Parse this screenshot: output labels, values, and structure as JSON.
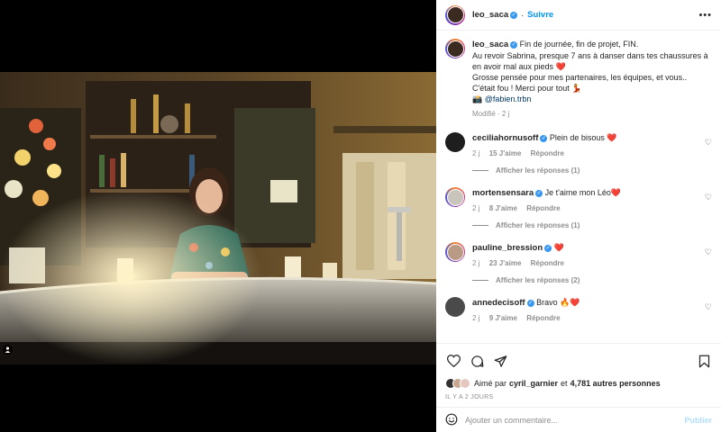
{
  "post": {
    "author": "leo_saca",
    "follow_label": "Suivre",
    "more_icon": "more-dots-icon"
  },
  "caption": {
    "author": "leo_saca",
    "line1": "Fin de journée, fin de projet, FIN.",
    "line2": "Au revoir Sabrina, presque 7 ans à danser dans tes chaussures à en avoir mal aux pieds ❤️",
    "line3": "Grosse pensée pour mes partenaires, les équipes, et vous..",
    "line4": "C'était fou ! Merci pour tout 💃",
    "line5_prefix": "📸",
    "mention": "@fabien.trbn",
    "edited": "Modifié · 2 j"
  },
  "comments": [
    {
      "user": "ceciliahornusoff",
      "text": "Plein de bisous ❤️",
      "age": "2 j",
      "likes": "15 J'aime",
      "reply": "Répondre",
      "replies": "Afficher les réponses (1)"
    },
    {
      "user": "mortensensara",
      "text": "Je t'aime mon Léo❤️",
      "age": "2 j",
      "likes": "8 J'aime",
      "reply": "Répondre",
      "replies": "Afficher les réponses (1)"
    },
    {
      "user": "pauline_bression",
      "text": "❤️",
      "age": "2 j",
      "likes": "23 J'aime",
      "reply": "Répondre",
      "replies": "Afficher les réponses (2)"
    },
    {
      "user": "annedecisoff",
      "text": "Bravo 🔥❤️",
      "age": "2 j",
      "likes": "9 J'aime",
      "reply": "Répondre",
      "replies": ""
    }
  ],
  "likes": {
    "prefix": "Aimé par",
    "user": "cyril_garnier",
    "conjunction": "et",
    "others": "4,781 autres personnes"
  },
  "time_ago": "IL Y A 2 JOURS",
  "composer": {
    "placeholder": "Ajouter un commentaire...",
    "publish_label": "Publier"
  },
  "colors": {
    "accent": "#0095f6",
    "verified": "#3897f0",
    "muted": "#8e8e8e",
    "publish_disabled": "#b2dffc"
  }
}
